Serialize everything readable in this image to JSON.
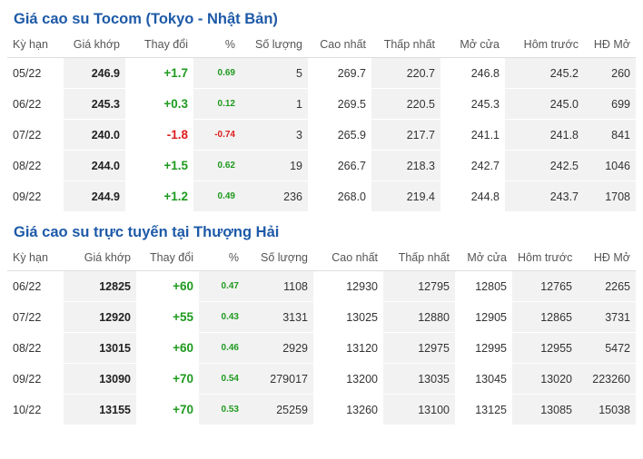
{
  "colors": {
    "title": "#1e5aa8",
    "up": "#1f9a1f",
    "down": "#e01c1c",
    "shade": "#f2f2f2"
  },
  "tocom": {
    "title": "Giá cao su Tocom (Tokyo - Nhật Bản)",
    "headers": [
      "Kỳ hạn",
      "Giá khớp",
      "Thay đổi",
      "%",
      "Số lượng",
      "Cao nhất",
      "Thấp nhất",
      "Mở cửa",
      "Hôm trước",
      "HĐ Mở"
    ],
    "rows": [
      {
        "dir": "up",
        "cells": [
          "05/22",
          "246.9",
          "+1.7",
          "0.69",
          "5",
          "269.7",
          "220.7",
          "246.8",
          "245.2",
          "260"
        ]
      },
      {
        "dir": "up",
        "cells": [
          "06/22",
          "245.3",
          "+0.3",
          "0.12",
          "1",
          "269.5",
          "220.5",
          "245.3",
          "245.0",
          "699"
        ]
      },
      {
        "dir": "down",
        "cells": [
          "07/22",
          "240.0",
          "-1.8",
          "-0.74",
          "3",
          "265.9",
          "217.7",
          "241.1",
          "241.8",
          "841"
        ]
      },
      {
        "dir": "up",
        "cells": [
          "08/22",
          "244.0",
          "+1.5",
          "0.62",
          "19",
          "266.7",
          "218.3",
          "242.7",
          "242.5",
          "1046"
        ]
      },
      {
        "dir": "up",
        "cells": [
          "09/22",
          "244.9",
          "+1.2",
          "0.49",
          "236",
          "268.0",
          "219.4",
          "244.8",
          "243.7",
          "1708"
        ]
      }
    ]
  },
  "shanghai": {
    "title": "Giá cao su trực tuyến tại Thượng Hải",
    "headers": [
      "Kỳ hạn",
      "Giá khớp",
      "Thay đổi",
      "%",
      "Số lượng",
      "Cao nhất",
      "Thấp nhất",
      "Mở cửa",
      "Hôm trước",
      "HĐ Mở"
    ],
    "rows": [
      {
        "dir": "up",
        "cells": [
          "06/22",
          "12825",
          "+60",
          "0.47",
          "1108",
          "12930",
          "12795",
          "12805",
          "12765",
          "2265"
        ]
      },
      {
        "dir": "up",
        "cells": [
          "07/22",
          "12920",
          "+55",
          "0.43",
          "3131",
          "13025",
          "12880",
          "12905",
          "12865",
          "3731"
        ]
      },
      {
        "dir": "up",
        "cells": [
          "08/22",
          "13015",
          "+60",
          "0.46",
          "2929",
          "13120",
          "12975",
          "12995",
          "12955",
          "5472"
        ]
      },
      {
        "dir": "up",
        "cells": [
          "09/22",
          "13090",
          "+70",
          "0.54",
          "279017",
          "13200",
          "13035",
          "13045",
          "13020",
          "223260"
        ]
      },
      {
        "dir": "up",
        "cells": [
          "10/22",
          "13155",
          "+70",
          "0.53",
          "25259",
          "13260",
          "13100",
          "13125",
          "13085",
          "15038"
        ]
      }
    ]
  }
}
